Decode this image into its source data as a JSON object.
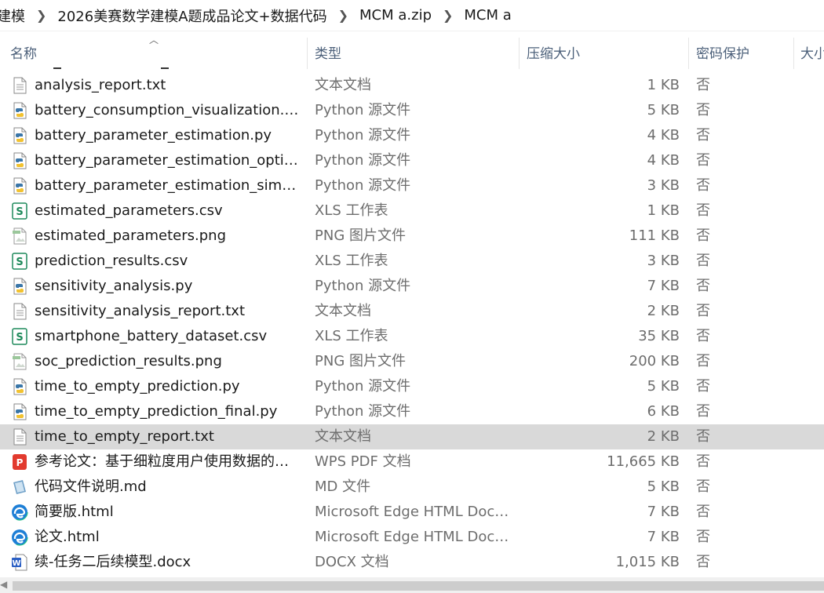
{
  "breadcrumb": [
    "建模",
    "2026美赛数学建模A题成品论文+数据代码",
    "MCM a.zip",
    "MCM a"
  ],
  "columns": {
    "name": "名称",
    "type": "类型",
    "compressed_size": "压缩大小",
    "password": "密码保护",
    "size": "大小"
  },
  "files": [
    {
      "name": "analysis_report.txt",
      "type": "文本文档",
      "size": "1 KB",
      "protected": "否",
      "icon": "text-file-icon"
    },
    {
      "name": "battery_consumption_visualization.py",
      "type": "Python 源文件",
      "size": "5 KB",
      "protected": "否",
      "icon": "python-file-icon"
    },
    {
      "name": "battery_parameter_estimation.py",
      "type": "Python 源文件",
      "size": "4 KB",
      "protected": "否",
      "icon": "python-file-icon"
    },
    {
      "name": "battery_parameter_estimation_optim...",
      "type": "Python 源文件",
      "size": "4 KB",
      "protected": "否",
      "icon": "python-file-icon"
    },
    {
      "name": "battery_parameter_estimation_simpl...",
      "type": "Python 源文件",
      "size": "3 KB",
      "protected": "否",
      "icon": "python-file-icon"
    },
    {
      "name": "estimated_parameters.csv",
      "type": "XLS 工作表",
      "size": "1 KB",
      "protected": "否",
      "icon": "spreadsheet-file-icon"
    },
    {
      "name": "estimated_parameters.png",
      "type": "PNG 图片文件",
      "size": "111 KB",
      "protected": "否",
      "icon": "image-file-icon"
    },
    {
      "name": "prediction_results.csv",
      "type": "XLS 工作表",
      "size": "3 KB",
      "protected": "否",
      "icon": "spreadsheet-file-icon"
    },
    {
      "name": "sensitivity_analysis.py",
      "type": "Python 源文件",
      "size": "7 KB",
      "protected": "否",
      "icon": "python-file-icon"
    },
    {
      "name": "sensitivity_analysis_report.txt",
      "type": "文本文档",
      "size": "2 KB",
      "protected": "否",
      "icon": "text-file-icon"
    },
    {
      "name": "smartphone_battery_dataset.csv",
      "type": "XLS 工作表",
      "size": "35 KB",
      "protected": "否",
      "icon": "spreadsheet-file-icon"
    },
    {
      "name": "soc_prediction_results.png",
      "type": "PNG 图片文件",
      "size": "200 KB",
      "protected": "否",
      "icon": "image-file-icon"
    },
    {
      "name": "time_to_empty_prediction.py",
      "type": "Python 源文件",
      "size": "5 KB",
      "protected": "否",
      "icon": "python-file-icon"
    },
    {
      "name": "time_to_empty_prediction_final.py",
      "type": "Python 源文件",
      "size": "6 KB",
      "protected": "否",
      "icon": "python-file-icon"
    },
    {
      "name": "time_to_empty_report.txt",
      "type": "文本文档",
      "size": "2 KB",
      "protected": "否",
      "icon": "text-file-icon",
      "selected": true
    },
    {
      "name": "参考论文：基于细粒度用户使用数据的智...",
      "type": "WPS PDF 文档",
      "size": "11,665 KB",
      "protected": "否",
      "icon": "pdf-file-icon"
    },
    {
      "name": "代码文件说明.md",
      "type": "MD 文件",
      "size": "5 KB",
      "protected": "否",
      "icon": "markdown-file-icon"
    },
    {
      "name": "简要版.html",
      "type": "Microsoft Edge HTML Docu...",
      "size": "7 KB",
      "protected": "否",
      "icon": "edge-file-icon"
    },
    {
      "name": "论文.html",
      "type": "Microsoft Edge HTML Docu...",
      "size": "7 KB",
      "protected": "否",
      "icon": "edge-file-icon"
    },
    {
      "name": "续-任务二后续模型.docx",
      "type": "DOCX 文档",
      "size": "1,015 KB",
      "protected": "否",
      "icon": "word-file-icon"
    }
  ],
  "colors": {
    "header_text": "#4c607a",
    "meta_text": "#6d6d6d",
    "selected_row": "#d9d9d9",
    "python_blue": "#3a76a8",
    "spreadsheet_green": "#1f8a5b",
    "pdf_red": "#e23a2e",
    "edge_blue": "#1e7fd6",
    "word_blue": "#2b5fc4"
  }
}
